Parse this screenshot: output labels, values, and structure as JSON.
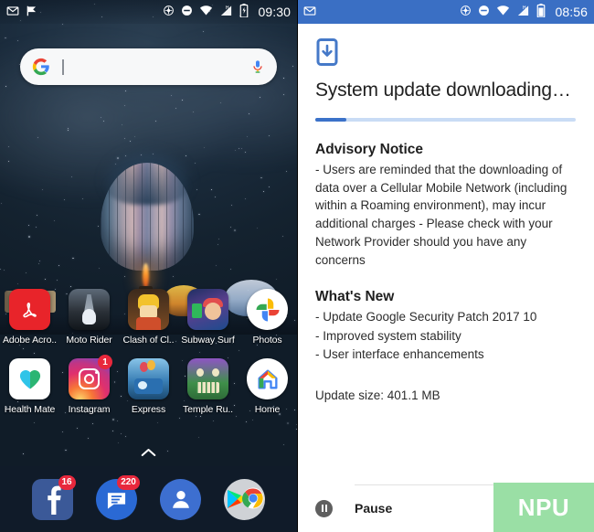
{
  "home": {
    "statusbar": {
      "notif_icons": [
        "gmail-icon",
        "tick-flag-icon"
      ],
      "system_icons": [
        "location-icon",
        "do-not-disturb-icon",
        "wifi-icon",
        "h-signal-icon",
        "battery-charging-icon"
      ],
      "clock": "09:30"
    },
    "search": {
      "logo": "google-g-logo",
      "value": "",
      "placeholder": "",
      "mic": "microphone-icon"
    },
    "app_rows": [
      [
        {
          "label": "Adobe Acro..",
          "icon": "adobe-acrobat-icon",
          "badge": ""
        },
        {
          "label": "Moto Rider",
          "icon": "moto-rider-icon",
          "badge": ""
        },
        {
          "label": "Clash of Cl..",
          "icon": "clash-of-clans-icon",
          "badge": ""
        },
        {
          "label": "Subway Surf",
          "icon": "subway-surfers-icon",
          "badge": ""
        },
        {
          "label": "Photos",
          "icon": "google-photos-icon",
          "badge": ""
        }
      ],
      [
        {
          "label": "Health Mate",
          "icon": "health-mate-icon",
          "badge": ""
        },
        {
          "label": "Instagram",
          "icon": "instagram-icon",
          "badge": "1"
        },
        {
          "label": "Express",
          "icon": "express-icon",
          "badge": ""
        },
        {
          "label": "Temple Ru..",
          "icon": "temple-run-icon",
          "badge": ""
        },
        {
          "label": "Home",
          "icon": "google-home-icon",
          "badge": ""
        }
      ]
    ],
    "drawer_handle": "˄",
    "dock": [
      {
        "name": "facebook",
        "icon": "facebook-icon",
        "badge": "16"
      },
      {
        "name": "messages",
        "icon": "messages-icon",
        "badge": "220"
      },
      {
        "name": "contacts",
        "icon": "contacts-icon",
        "badge": ""
      },
      {
        "name": "play-store",
        "icon": "play-store-chrome-folder-icon",
        "badge": ""
      }
    ]
  },
  "update": {
    "statusbar": {
      "notif_icons": [
        "gmail-icon"
      ],
      "system_icons": [
        "location-icon",
        "do-not-disturb-icon",
        "wifi-icon",
        "h-signal-icon",
        "battery-icon"
      ],
      "clock": "08:56",
      "bg_color": "#3a6fc4"
    },
    "header_icon": "phone-download-icon",
    "title": "System update downloading…",
    "progress": {
      "percent": 12,
      "fill_color": "#3b72c9",
      "track_color": "#c9dcf5"
    },
    "sections": [
      {
        "heading": "Advisory Notice",
        "body": "- Users are reminded that the downloading of data over a Cellular Mobile Network (including within a Roaming environment), may incur additional charges - Please check with your Network Provider should you have any concerns"
      }
    ],
    "whats_new": {
      "heading": "What's New",
      "items": [
        "- Update Google Security Patch 2017 10",
        "- Improved system stability",
        "- User interface enhancements"
      ]
    },
    "update_size": "Update size: 401.1 MB",
    "action": {
      "icon": "pause-icon",
      "label": "Pause"
    },
    "watermark": {
      "text": "NPU",
      "bg_color": "#9adfa5"
    }
  }
}
